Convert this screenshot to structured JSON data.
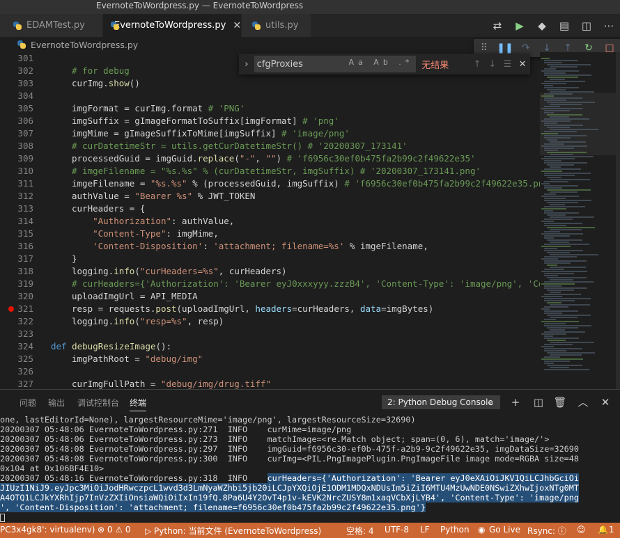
{
  "window": {
    "title": "EvernoteToWordpress.py — EvernoteToWordpress"
  },
  "tabs": [
    {
      "label": "EDAMTest.py"
    },
    {
      "label": "EvernoteToWordpress.py",
      "close": "✕"
    },
    {
      "label": "utils.py"
    }
  ],
  "breadcrumb": {
    "file": "EvernoteToWordpress.py"
  },
  "find": {
    "query": "cfgProxies",
    "options": "Aa Ab .*",
    "no_results": "无结果"
  },
  "code": {
    "lines": [
      {
        "n": "301",
        "t": ""
      },
      {
        "n": "302",
        "t": "# for debug"
      },
      {
        "n": "303",
        "t": "curImg.show()"
      },
      {
        "n": "304",
        "t": ""
      },
      {
        "n": "305",
        "t": "imgFormat = curImg.format # 'PNG'"
      },
      {
        "n": "306",
        "t": "imgSuffix = gImageFormatToSuffix[imgFormat] # 'png'"
      },
      {
        "n": "307",
        "t": "imgMime = gImageSuffixToMime[imgSuffix] # 'image/png'"
      },
      {
        "n": "308",
        "t": "# curDatetimeStr = utils.getCurDatetimeStr() # '20200307_173141'"
      },
      {
        "n": "309",
        "t": "processedGuid = imgGuid.replace(\"-\", \"\") # 'f6956c30ef0b475fa2b99c2f49622e35'"
      },
      {
        "n": "310",
        "t": "# imgeFilename = \"%s.%s\" % (curDatetimeStr, imgSuffix) # '20200307_173141.png'"
      },
      {
        "n": "311",
        "t": "imgeFilename = \"%s.%s\" % (processedGuid, imgSuffix) # 'f6956c30ef0b475fa2b99c2f49622e35.png'"
      },
      {
        "n": "312",
        "t": "authValue = \"Bearer %s\" % JWT_TOKEN"
      },
      {
        "n": "313",
        "t": "curHeaders = {"
      },
      {
        "n": "314",
        "t": "    \"Authorization\": authValue,"
      },
      {
        "n": "315",
        "t": "    \"Content-Type\": imgMime,"
      },
      {
        "n": "316",
        "t": "    'Content-Disposition': 'attachment; filename=%s' % imgeFilename,"
      },
      {
        "n": "317",
        "t": "}"
      },
      {
        "n": "318",
        "t": "logging.info(\"curHeaders=%s\", curHeaders)"
      },
      {
        "n": "319",
        "t": "# curHeaders={'Authorization': 'Bearer eyJ0xxxyyy.zzzB4', 'Content-Type': 'image/png', 'Conte"
      },
      {
        "n": "320",
        "t": "uploadImgUrl = API_MEDIA"
      },
      {
        "n": "321",
        "t": "resp = requests.post(uploadImgUrl, headers=curHeaders, data=imgBytes)"
      },
      {
        "n": "322",
        "t": "logging.info(\"resp=%s\", resp)"
      },
      {
        "n": "323",
        "t": ""
      },
      {
        "n": "324",
        "t": "def debugResizeImage():"
      },
      {
        "n": "325",
        "t": "imgPathRoot = \"debug/img\""
      },
      {
        "n": "326",
        "t": ""
      },
      {
        "n": "327",
        "t": "curImgFullPath = \"debug/img/drug.tiff\""
      }
    ]
  },
  "panel": {
    "tabs": [
      "问题",
      "输出",
      "调试控制台",
      "终端"
    ],
    "console_select": "2: Python Debug Console",
    "terminal": [
      "one, lastEditorId=None), largestResourceMime='image/png', largestResourceSize=32690)",
      "20200307 05:48:06 EvernoteToWordpress.py:271  INFO    curMime=image/png",
      "20200307 05:48:06 EvernoteToWordpress.py:273  INFO    matchImage=<re.Match object; span=(0, 6), match='image/'>",
      "20200307 05:48:08 EvernoteToWordpress.py:297  INFO    imgGuid=f6956c30-ef0b-475f-a2b9-9c2f49622e35, imgDataSize=32690",
      "20200307 05:48:08 EvernoteToWordpress.py:300  INFO    curImg=<PIL.PngImagePlugin.PngImageFile image mode=RGBA size=48",
      "0x104 at 0x106BF4E10>",
      "20200307 05:48:16 EvernoteToWordpress.py:318  INFO    ",
      "curHeaders={'Authorization': 'Bearer eyJ0eXAiOiJKV1QiLCJhbGciOi",
      "JIUzI1NiJ9.eyJpc3MiOiJodHRwczpcL1wvd3d3LmNyaWZhbi5jb20iLCJpYXQiOjE1ODM1MDQxNDUsIm5iZiI6MTU4MzUwNDE0NSwiZXhwIjoxNTg0MT",
      "A4OTQ1LCJkYXRhIjp7InVzZXIiOnsiaWQiOiIxIn19fQ.8Pa6U4Y2OvT4p1v-kEVK2NrcZUSY8m1xaqVCbXjLYB4', 'Content-Type': 'image/png",
      "', 'Content-Disposition': 'attachment; filename=f6956c30ef0b475fa2b99c2f49622e35.png'}"
    ]
  },
  "status": {
    "env": "PC3x4gk8': virtualenv)",
    "problems": "⊗ 0 ⚠ 0",
    "debug": "▷ Python: 当前文件 (EvernoteToWordpress)",
    "spaces": "空格: 4",
    "encoding": "UTF-8",
    "eol": "LF",
    "language": "Python",
    "golive": "Go Live",
    "rsync": "Rsync: ⓘ",
    "bell": "1"
  },
  "colors": {
    "statusbar": "#cc6633",
    "breakpoint": "#e51400",
    "selection": "#264f78"
  }
}
